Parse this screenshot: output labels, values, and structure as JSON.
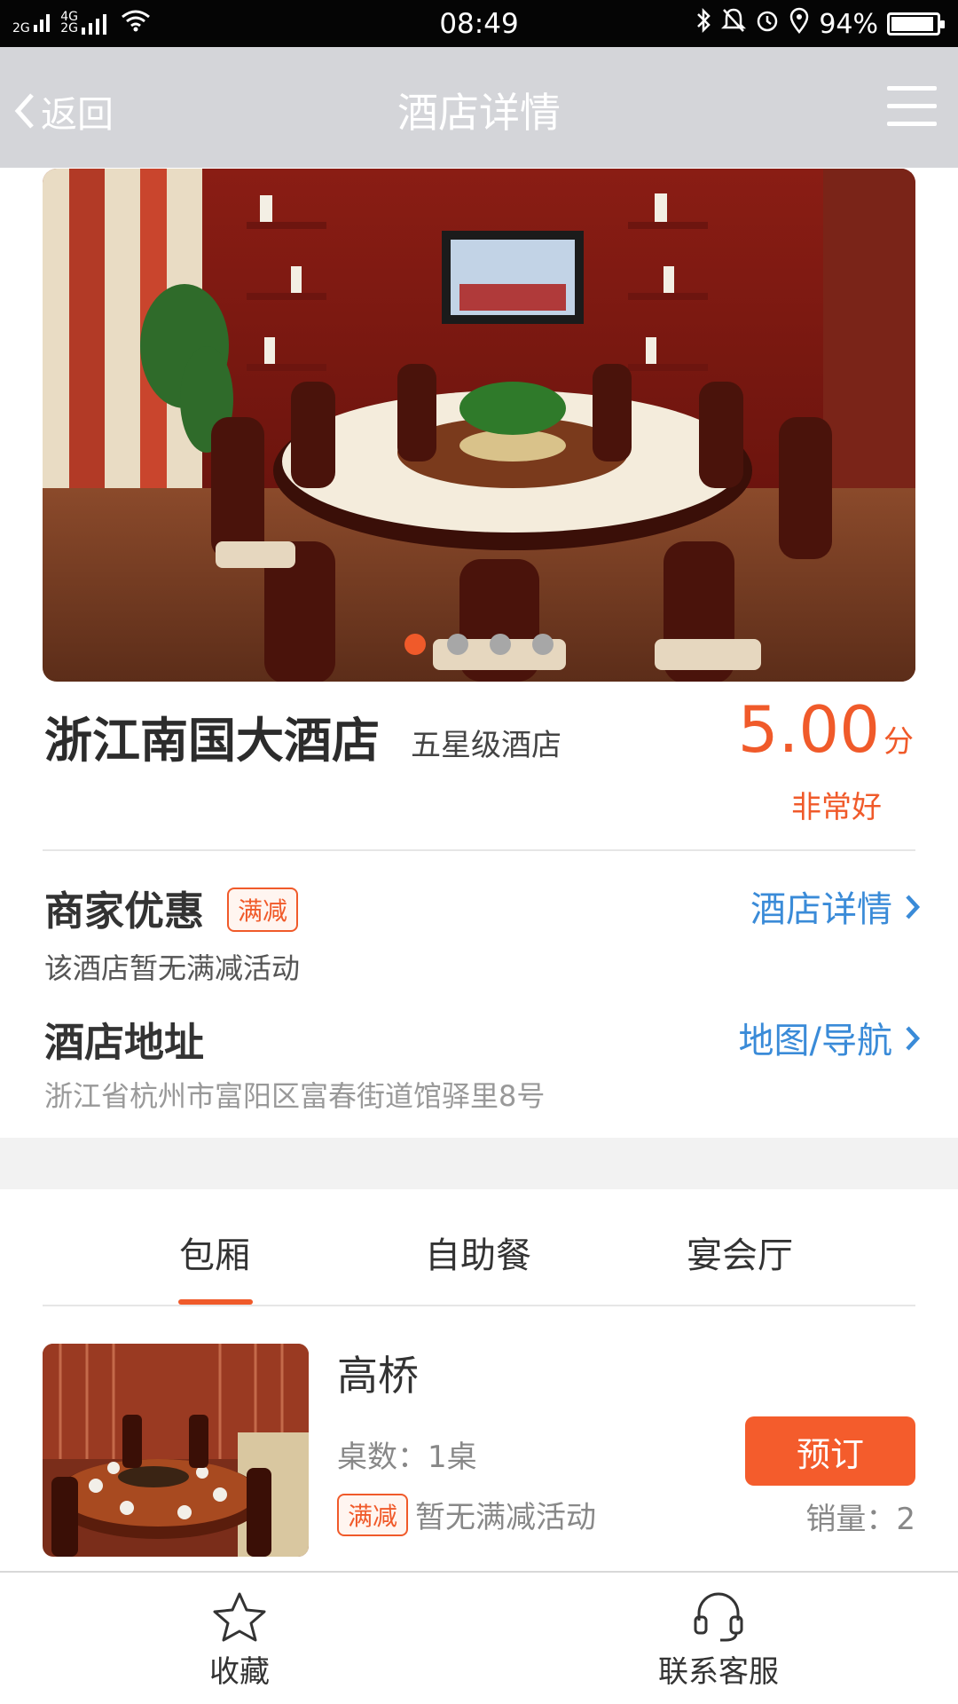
{
  "status_bar": {
    "signal_left": "2G",
    "signal_right_top": "4G",
    "signal_right_bottom": "2G",
    "time": "08:49",
    "battery": "94%",
    "battery_level": 0.94
  },
  "nav": {
    "back_label": "返回",
    "title": "酒店详情"
  },
  "carousel": {
    "slide_count": 4,
    "active_index": 0
  },
  "hotel": {
    "name": "浙江南国大酒店",
    "star_level": "五星级酒店",
    "score": "5.00",
    "score_unit": "分",
    "score_desc": "非常好"
  },
  "promo": {
    "title": "商家优惠",
    "tag": "满减",
    "text": "该酒店暂无满减活动",
    "link": "酒店详情"
  },
  "address": {
    "title": "酒店地址",
    "text": "浙江省杭州市富阳区富春街道馆驿里8号",
    "link": "地图/导航"
  },
  "tabs": [
    {
      "label": "包厢",
      "active": true
    },
    {
      "label": "自助餐",
      "active": false
    },
    {
      "label": "宴会厅",
      "active": false
    }
  ],
  "room": {
    "name": "高桥",
    "tables": "桌数：1桌",
    "promo_tag": "满减",
    "promo_text": "暂无满减活动",
    "book_label": "预订",
    "sales": "销量：2"
  },
  "bottom_bar": {
    "favorite_label": "收藏",
    "service_label": "联系客服"
  },
  "colors": {
    "accent": "#f05a2a",
    "link": "#3a8bd8",
    "nav_bg": "#d4d5d9"
  }
}
